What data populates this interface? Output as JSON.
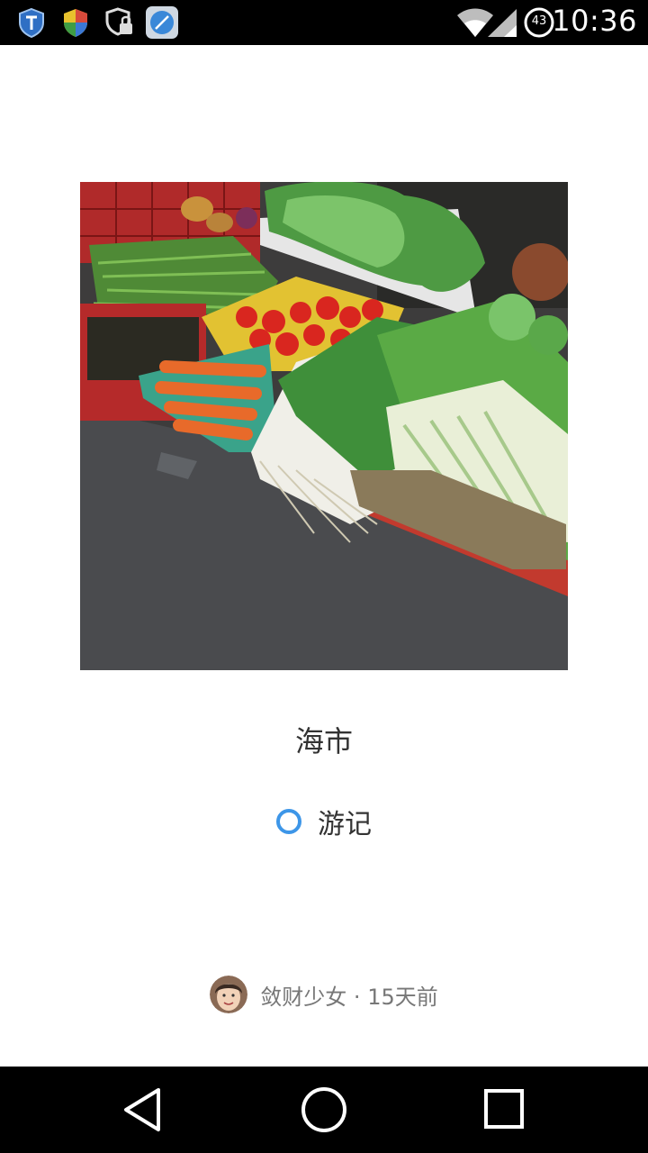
{
  "status_bar": {
    "time": "10:36",
    "battery_level": "43",
    "left_icons": [
      "shield-app-icon",
      "security-shield-icon",
      "lock-shield-icon",
      "compass-icon"
    ],
    "right_icons": [
      "wifi-icon",
      "cell-signal-icon",
      "battery-icon"
    ]
  },
  "post": {
    "image_name": "vegetable-market-photo",
    "title": "海市",
    "tag": "游记",
    "tag_color": "#3d96e8",
    "author": "敛财少女",
    "separator": "·",
    "time_ago": "15天前"
  },
  "nav_bar": {
    "icons": [
      "back-icon",
      "home-icon",
      "recents-icon"
    ]
  }
}
